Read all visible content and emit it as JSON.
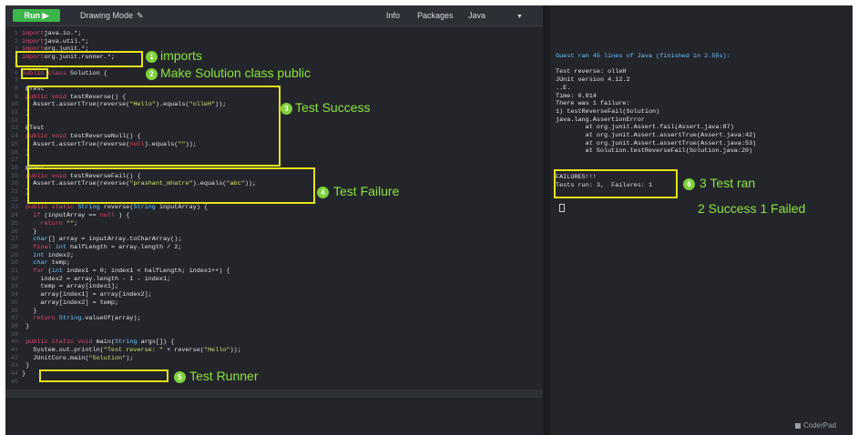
{
  "toolbar": {
    "run_label": "Run ▶",
    "drawing_mode": "Drawing Mode",
    "info": "Info",
    "packages": "Packages",
    "language": "Java",
    "language_caret": "▼"
  },
  "editor": {
    "lines": [
      {
        "n": "1",
        "segs": [
          [
            "kw",
            "import"
          ],
          [
            "",
            "java.io.*;"
          ]
        ]
      },
      {
        "n": "2",
        "segs": [
          [
            "kw",
            "import"
          ],
          [
            "",
            "java.util.*;"
          ]
        ]
      },
      {
        "n": "3",
        "segs": [
          [
            "kw",
            "import"
          ],
          [
            "",
            "org.junit.*;"
          ]
        ]
      },
      {
        "n": "4",
        "segs": [
          [
            "kw",
            "import"
          ],
          [
            "",
            "org.junit.runner.*;"
          ]
        ]
      },
      {
        "n": "5",
        "segs": [
          [
            "",
            ""
          ]
        ]
      },
      {
        "n": "6",
        "segs": [
          [
            "kw",
            "public"
          ],
          [
            "kw",
            " class"
          ],
          [
            "",
            " Solution {"
          ]
        ]
      },
      {
        "n": "7",
        "segs": [
          [
            "",
            ""
          ]
        ]
      },
      {
        "n": "8",
        "segs": [
          [
            "",
            " @Test"
          ]
        ]
      },
      {
        "n": "9",
        "segs": [
          [
            "kw",
            " public"
          ],
          [
            "kw",
            " void"
          ],
          [
            "",
            " testReverse() {"
          ]
        ]
      },
      {
        "n": "10",
        "segs": [
          [
            "",
            "   Assert.assertTrue(reverse("
          ],
          [
            "st",
            "\"Hello\""
          ],
          [
            "",
            ").equals("
          ],
          [
            "st",
            "\"olleH\""
          ],
          [
            "",
            "));"
          ]
        ]
      },
      {
        "n": "11",
        "segs": [
          [
            "",
            " }"
          ]
        ]
      },
      {
        "n": "12",
        "segs": [
          [
            "",
            ""
          ]
        ]
      },
      {
        "n": "13",
        "segs": [
          [
            "",
            " @Test"
          ]
        ]
      },
      {
        "n": "14",
        "segs": [
          [
            "kw",
            " public"
          ],
          [
            "kw",
            " void"
          ],
          [
            "",
            " testReverseNull() {"
          ]
        ]
      },
      {
        "n": "15",
        "segs": [
          [
            "",
            "   Assert.assertTrue(reverse("
          ],
          [
            "kw",
            "null"
          ],
          [
            "",
            ").equals("
          ],
          [
            "st",
            "\"\""
          ],
          [
            "",
            "));"
          ]
        ]
      },
      {
        "n": "16",
        "segs": [
          [
            "",
            " }"
          ]
        ]
      },
      {
        "n": "17",
        "segs": [
          [
            "",
            ""
          ]
        ]
      },
      {
        "n": "18",
        "segs": [
          [
            "",
            " @Test"
          ]
        ]
      },
      {
        "n": "19",
        "segs": [
          [
            "kw",
            " public"
          ],
          [
            "kw",
            " void"
          ],
          [
            "",
            " testReverseFail() {"
          ]
        ]
      },
      {
        "n": "20",
        "segs": [
          [
            "",
            "   Assert.assertTrue(reverse("
          ],
          [
            "st",
            "\"prashant_mhatre\""
          ],
          [
            "",
            ").equals("
          ],
          [
            "st",
            "\"abc\""
          ],
          [
            "",
            "));"
          ]
        ]
      },
      {
        "n": "21",
        "segs": [
          [
            "",
            " }"
          ]
        ]
      },
      {
        "n": "22",
        "segs": [
          [
            "",
            ""
          ]
        ]
      },
      {
        "n": "23",
        "segs": [
          [
            "kw",
            " public"
          ],
          [
            "kw",
            " static"
          ],
          [
            "ty",
            " String"
          ],
          [
            "",
            " reverse("
          ],
          [
            "ty",
            "String"
          ],
          [
            "",
            " inputArray) {"
          ]
        ]
      },
      {
        "n": "24",
        "segs": [
          [
            "kw",
            "   if"
          ],
          [
            "",
            " (inputArray == "
          ],
          [
            "kw",
            "null"
          ],
          [
            "",
            " ) {"
          ]
        ]
      },
      {
        "n": "25",
        "segs": [
          [
            "kw",
            "     return"
          ],
          [
            "st",
            " \"\""
          ],
          [
            "",
            ";"
          ]
        ]
      },
      {
        "n": "26",
        "segs": [
          [
            "",
            "   }"
          ]
        ]
      },
      {
        "n": "27",
        "segs": [
          [
            "ty",
            "   char"
          ],
          [
            "",
            "[] array = inputArray.toCharArray();"
          ]
        ]
      },
      {
        "n": "28",
        "segs": [
          [
            "kw",
            "   final"
          ],
          [
            "ty",
            " int"
          ],
          [
            "",
            " halfLength = array.length / 2;"
          ]
        ]
      },
      {
        "n": "29",
        "segs": [
          [
            "ty",
            "   int"
          ],
          [
            "",
            " index2;"
          ]
        ]
      },
      {
        "n": "30",
        "segs": [
          [
            "ty",
            "   char"
          ],
          [
            "",
            " temp;"
          ]
        ]
      },
      {
        "n": "31",
        "segs": [
          [
            "kw",
            "   for"
          ],
          [
            "",
            " ("
          ],
          [
            "ty",
            "int"
          ],
          [
            "",
            " index1 = 0; index1 < halfLength; index1++) {"
          ]
        ]
      },
      {
        "n": "32",
        "segs": [
          [
            "",
            "     index2 = array.length - 1 - index1;"
          ]
        ]
      },
      {
        "n": "33",
        "segs": [
          [
            "",
            "     temp = array[index1];"
          ]
        ]
      },
      {
        "n": "34",
        "segs": [
          [
            "",
            "     array[index1] = array[index2];"
          ]
        ]
      },
      {
        "n": "35",
        "segs": [
          [
            "",
            "     array[index2] = temp;"
          ]
        ]
      },
      {
        "n": "36",
        "segs": [
          [
            "",
            "   }"
          ]
        ]
      },
      {
        "n": "37",
        "segs": [
          [
            "kw",
            "   return"
          ],
          [
            "ty",
            " String"
          ],
          [
            "",
            ".valueOf(array);"
          ]
        ]
      },
      {
        "n": "38",
        "segs": [
          [
            "",
            " }"
          ]
        ]
      },
      {
        "n": "39",
        "segs": [
          [
            "",
            ""
          ]
        ]
      },
      {
        "n": "40",
        "segs": [
          [
            "kw",
            " public"
          ],
          [
            "kw",
            " static"
          ],
          [
            "kw",
            " void"
          ],
          [
            "",
            " main("
          ],
          [
            "ty",
            "String"
          ],
          [
            "",
            " args[]) {"
          ]
        ]
      },
      {
        "n": "41",
        "segs": [
          [
            "",
            "   System.out.println("
          ],
          [
            "st",
            "\"Test reverse: \""
          ],
          [
            "",
            " + reverse("
          ],
          [
            "st",
            "\"Hello\""
          ],
          [
            "",
            "));"
          ]
        ]
      },
      {
        "n": "42",
        "segs": [
          [
            "",
            "   JUnitCore.main("
          ],
          [
            "st",
            "\"Solution\""
          ],
          [
            "",
            ");"
          ]
        ]
      },
      {
        "n": "43",
        "segs": [
          [
            "",
            " }"
          ]
        ]
      },
      {
        "n": "44",
        "segs": [
          [
            "",
            "}"
          ]
        ]
      },
      {
        "n": "45",
        "segs": [
          [
            "",
            ""
          ]
        ]
      }
    ]
  },
  "console": {
    "lines": [
      {
        "cls": "ty",
        "text": "Guest ran 45 lines of Java (finished in 2.55s):"
      },
      {
        "cls": "",
        "text": ""
      },
      {
        "cls": "",
        "text": "Test reverse: olleH"
      },
      {
        "cls": "",
        "text": "JUnit version 4.12.2"
      },
      {
        "cls": "",
        "text": "..E."
      },
      {
        "cls": "",
        "text": "Time: 0.014"
      },
      {
        "cls": "",
        "text": "There was 1 failure:"
      },
      {
        "cls": "",
        "text": "1) testReverseFail(Solution)"
      },
      {
        "cls": "",
        "text": "java.lang.AssertionError"
      },
      {
        "cls": "",
        "text": "        at org.junit.Assert.fail(Assert.java:87)"
      },
      {
        "cls": "",
        "text": "        at org.junit.Assert.assertTrue(Assert.java:42)"
      },
      {
        "cls": "",
        "text": "        at org.junit.Assert.assertTrue(Assert.java:53)"
      },
      {
        "cls": "",
        "text": "        at Solution.testReverseFail(Solution.java:20)"
      },
      {
        "cls": "",
        "text": ""
      },
      {
        "cls": "",
        "text": "FAILURES!!!"
      },
      {
        "cls": "",
        "text": "Tests run: 3,  Failures: 1"
      }
    ]
  },
  "annotations": [
    {
      "num": "1",
      "label": "imports"
    },
    {
      "num": "2",
      "label": "Make Solution class public"
    },
    {
      "num": "3",
      "label": "Test Success"
    },
    {
      "num": "4",
      "label": "Test Failure"
    },
    {
      "num": "5",
      "label": "Test Runner"
    },
    {
      "num": "6",
      "label": "3 Test ran"
    },
    {
      "num": "",
      "label": "2 Success 1 Failed"
    }
  ],
  "branding": {
    "logo": "CoderPad"
  },
  "colors": {
    "accent_run": "#3cb54a",
    "highlight": "#e4e31a",
    "annotation": "#8fe33a",
    "keyword": "#e2466a",
    "string": "#d8e36a",
    "type": "#6fc5ff"
  }
}
